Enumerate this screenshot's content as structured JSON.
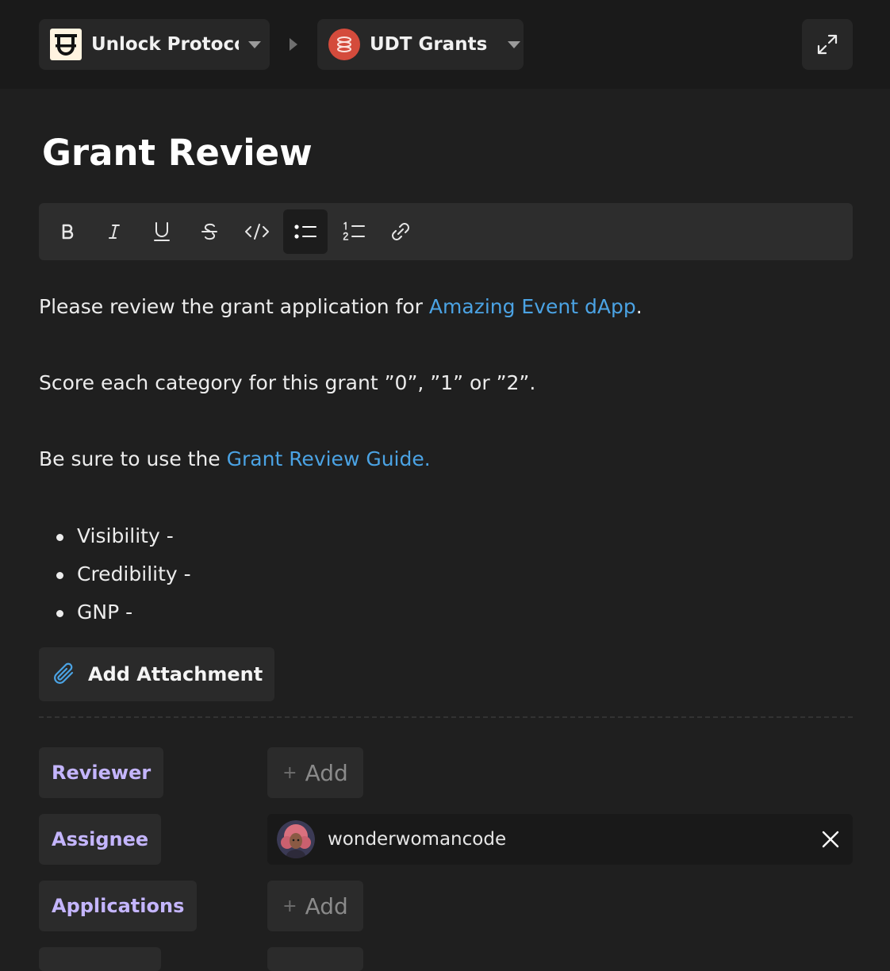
{
  "header": {
    "workspace_name": "Unlock Protocol",
    "project_name": "UDT Grants"
  },
  "document": {
    "title": "Grant Review",
    "paragraph1_prefix": "Please review the grant application for ",
    "paragraph1_link": "Amazing Event dApp",
    "paragraph1_suffix": ".",
    "paragraph2": "Score each category for this grant ”0”, ”1” or ”2”.",
    "paragraph3_prefix": "Be sure to use the ",
    "paragraph3_link": "Grant Review Guide.",
    "bullets": [
      "Visibility -",
      "Credibility -",
      "GNP -"
    ]
  },
  "toolbar": {
    "tools": [
      "bold",
      "italic",
      "underline",
      "strikethrough",
      "code",
      "bullet-list",
      "numbered-list",
      "link"
    ],
    "active": "bullet-list"
  },
  "attachment": {
    "label": "Add Attachment"
  },
  "properties": {
    "reviewer": {
      "label": "Reviewer",
      "add_label": "Add"
    },
    "assignee": {
      "label": "Assignee",
      "value": "wonderwomancode"
    },
    "applications": {
      "label": "Applications",
      "add_label": "Add"
    },
    "add_symbol": "+"
  },
  "colors": {
    "background": "#1f1f1f",
    "link": "#4ba3e4",
    "property_label": "#c4b5fd",
    "project_logo": "#d44b3c"
  }
}
